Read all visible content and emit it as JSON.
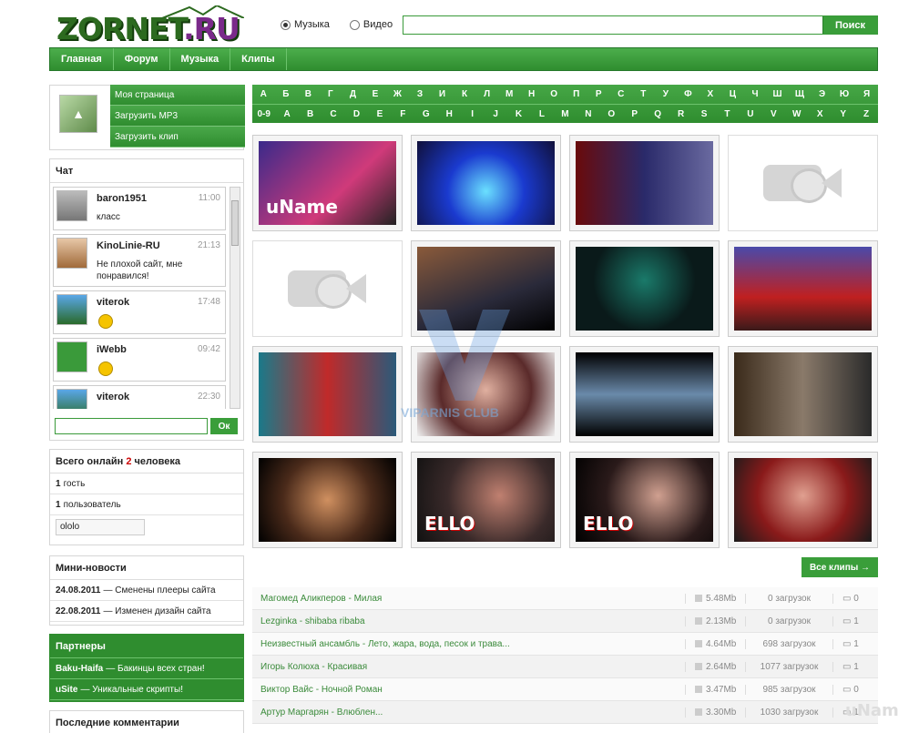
{
  "site": {
    "logo": "ZORNET.RU"
  },
  "search": {
    "option_music": "Музыка",
    "option_video": "Видео",
    "selected": "Музыка",
    "placeholder": "",
    "button": "Поиск"
  },
  "nav": [
    {
      "label": "Главная"
    },
    {
      "label": "Форум"
    },
    {
      "label": "Музыка"
    },
    {
      "label": "Клипы"
    }
  ],
  "user_menu": [
    {
      "label": "Моя страница"
    },
    {
      "label": "Загрузить MP3"
    },
    {
      "label": "Загрузить клип"
    }
  ],
  "chat": {
    "title": "Чат",
    "messages": [
      {
        "user": "baron1951",
        "time": "11:00",
        "text": "класс"
      },
      {
        "user": "KinoLinie-RU",
        "time": "21:13",
        "text": "Не плохой сайт, мне понравился!"
      },
      {
        "user": "viterok",
        "time": "17:48",
        "text": ""
      },
      {
        "user": "iWebb",
        "time": "09:42",
        "text": ""
      },
      {
        "user": "viterok",
        "time": "22:30",
        "text": ""
      }
    ],
    "send": "Ок"
  },
  "online": {
    "prefix": "Всего онлайн",
    "count": "2",
    "suffix": "человека",
    "guests_count": "1",
    "guests": "гость",
    "users_count": "1",
    "users": "пользователь",
    "user_name": "ololo"
  },
  "news": {
    "title": "Мини-новости",
    "items": [
      {
        "date": "24.08.2011",
        "text": "— Сменены плееры сайта"
      },
      {
        "date": "22.08.2011",
        "text": "— Изменен дизайн сайта"
      }
    ]
  },
  "partners": {
    "title": "Партнеры",
    "items": [
      {
        "name": "Baku-Haifa",
        "text": "— Бакинцы всех стран!"
      },
      {
        "name": "uSite",
        "text": "— Уникальные скрипты!"
      }
    ]
  },
  "comments": {
    "title": "Последние комментарии"
  },
  "alphabet": {
    "cyr": [
      "А",
      "Б",
      "В",
      "Г",
      "Д",
      "Е",
      "Ж",
      "З",
      "И",
      "К",
      "Л",
      "М",
      "Н",
      "О",
      "П",
      "Р",
      "С",
      "Т",
      "У",
      "Ф",
      "Х",
      "Ц",
      "Ч",
      "Ш",
      "Щ",
      "Э",
      "Ю",
      "Я"
    ],
    "lat": [
      "0-9",
      "A",
      "B",
      "C",
      "D",
      "E",
      "F",
      "G",
      "H",
      "I",
      "J",
      "K",
      "L",
      "M",
      "N",
      "O",
      "P",
      "Q",
      "R",
      "S",
      "T",
      "U",
      "V",
      "W",
      "X",
      "Y",
      "Z"
    ]
  },
  "thumb_label": "uName",
  "ello_label": "ELLO",
  "all_clips": "Все клипы →",
  "watermark": "VIPARNIS CLUB",
  "corner_mark": "uNam",
  "tracks": [
    {
      "title": "Магомед Аликперов - Милая",
      "size": "5.48Mb",
      "downloads": "0 загрузок",
      "comments": "0"
    },
    {
      "title": "Lezginka - shibaba ribaba",
      "size": "2.13Mb",
      "downloads": "0 загрузок",
      "comments": "1"
    },
    {
      "title": "Неизвестный ансамбль - Лето, жара, вода, песок и трава...",
      "size": "4.64Mb",
      "downloads": "698 загрузок",
      "comments": "1"
    },
    {
      "title": "Игорь Колюха - Красивая",
      "size": "2.64Mb",
      "downloads": "1077 загрузок",
      "comments": "1"
    },
    {
      "title": "Виктор Вайс - Ночной Роман",
      "size": "3.47Mb",
      "downloads": "985 загрузок",
      "comments": "0"
    },
    {
      "title": "Артур Маргарян - Влюблен...",
      "size": "3.30Mb",
      "downloads": "1030 загрузок",
      "comments": "1"
    }
  ]
}
